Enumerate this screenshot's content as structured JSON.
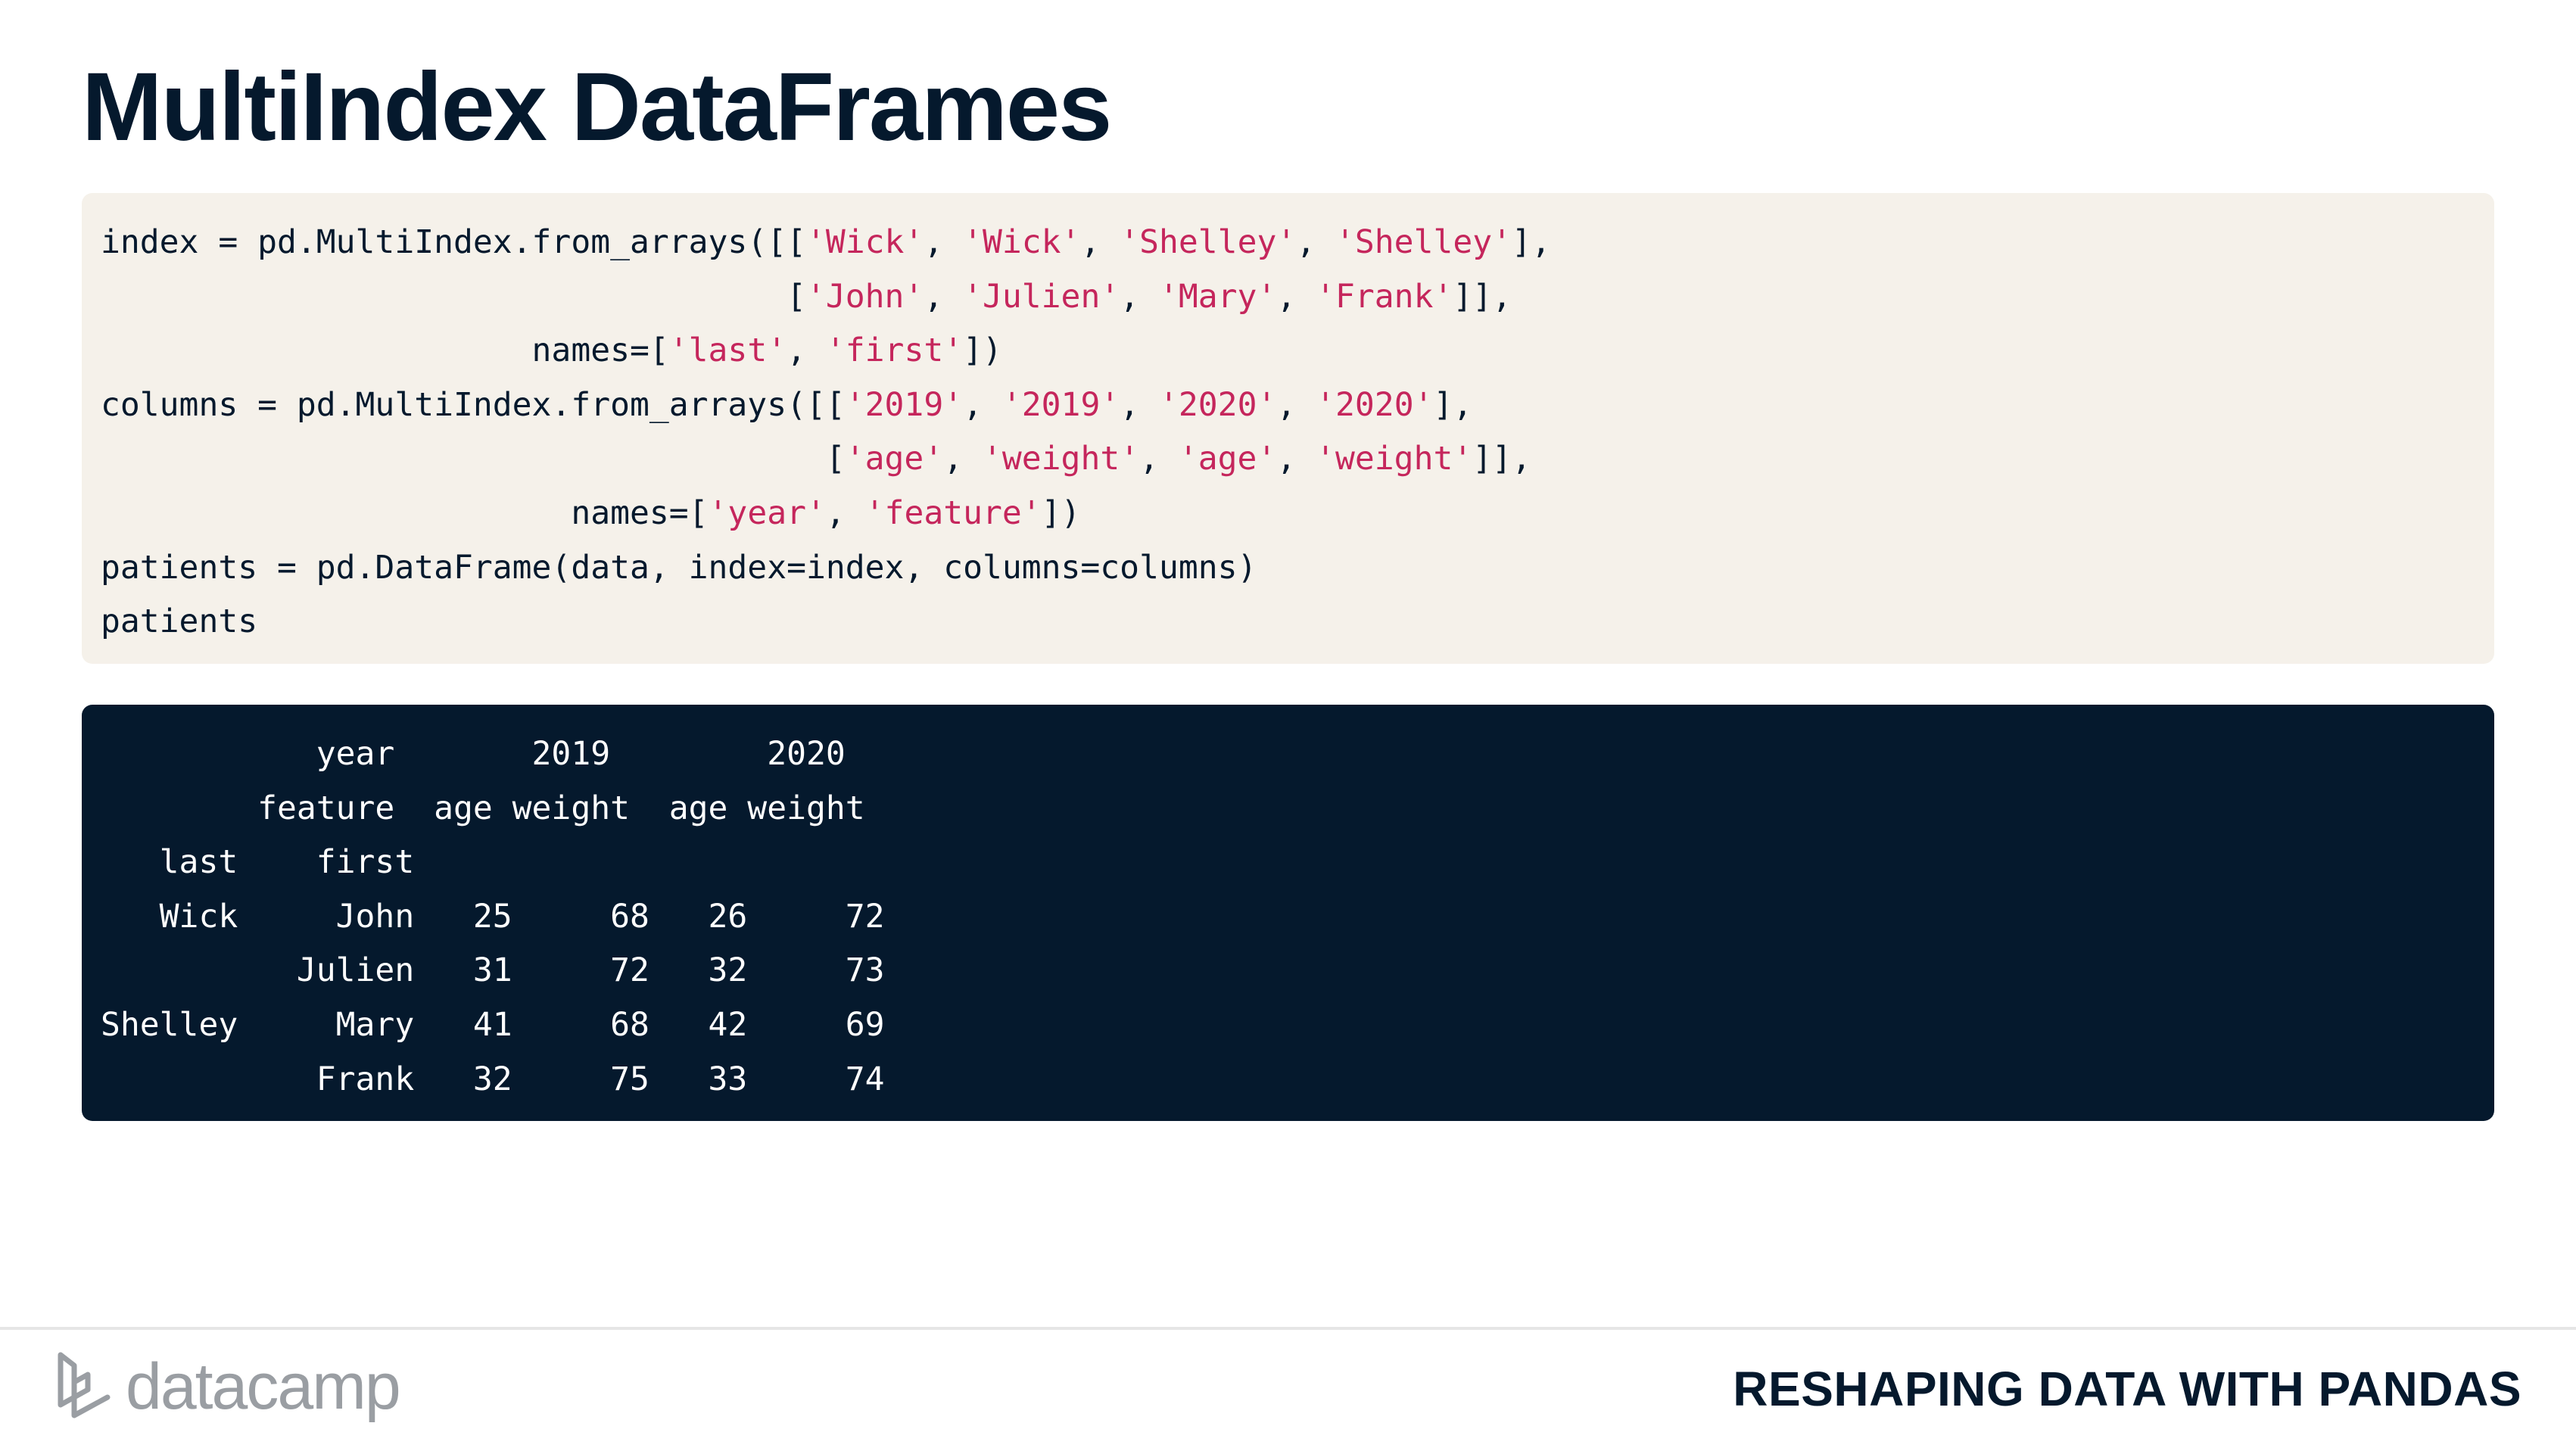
{
  "slide": {
    "title": "MultiIndex DataFrames"
  },
  "code": {
    "lines": [
      [
        {
          "t": "index = pd.MultiIndex.from_arrays([[",
          "k": "plain"
        },
        {
          "t": "'Wick'",
          "k": "str"
        },
        {
          "t": ", ",
          "k": "plain"
        },
        {
          "t": "'Wick'",
          "k": "str"
        },
        {
          "t": ", ",
          "k": "plain"
        },
        {
          "t": "'Shelley'",
          "k": "str"
        },
        {
          "t": ", ",
          "k": "plain"
        },
        {
          "t": "'Shelley'",
          "k": "str"
        },
        {
          "t": "],",
          "k": "plain"
        }
      ],
      [
        {
          "t": "                                   [",
          "k": "plain"
        },
        {
          "t": "'John'",
          "k": "str"
        },
        {
          "t": ", ",
          "k": "plain"
        },
        {
          "t": "'Julien'",
          "k": "str"
        },
        {
          "t": ", ",
          "k": "plain"
        },
        {
          "t": "'Mary'",
          "k": "str"
        },
        {
          "t": ", ",
          "k": "plain"
        },
        {
          "t": "'Frank'",
          "k": "str"
        },
        {
          "t": "]],",
          "k": "plain"
        }
      ],
      [
        {
          "t": "                      names=[",
          "k": "plain"
        },
        {
          "t": "'last'",
          "k": "str"
        },
        {
          "t": ", ",
          "k": "plain"
        },
        {
          "t": "'first'",
          "k": "str"
        },
        {
          "t": "])",
          "k": "plain"
        }
      ],
      [
        {
          "t": "columns = pd.MultiIndex.from_arrays([[",
          "k": "plain"
        },
        {
          "t": "'2019'",
          "k": "str"
        },
        {
          "t": ", ",
          "k": "plain"
        },
        {
          "t": "'2019'",
          "k": "str"
        },
        {
          "t": ", ",
          "k": "plain"
        },
        {
          "t": "'2020'",
          "k": "str"
        },
        {
          "t": ", ",
          "k": "plain"
        },
        {
          "t": "'2020'",
          "k": "str"
        },
        {
          "t": "],",
          "k": "plain"
        }
      ],
      [
        {
          "t": "                                     [",
          "k": "plain"
        },
        {
          "t": "'age'",
          "k": "str"
        },
        {
          "t": ", ",
          "k": "plain"
        },
        {
          "t": "'weight'",
          "k": "str"
        },
        {
          "t": ", ",
          "k": "plain"
        },
        {
          "t": "'age'",
          "k": "str"
        },
        {
          "t": ", ",
          "k": "plain"
        },
        {
          "t": "'weight'",
          "k": "str"
        },
        {
          "t": "]],",
          "k": "plain"
        }
      ],
      [
        {
          "t": "                        names=[",
          "k": "plain"
        },
        {
          "t": "'year'",
          "k": "str"
        },
        {
          "t": ", ",
          "k": "plain"
        },
        {
          "t": "'feature'",
          "k": "str"
        },
        {
          "t": "])",
          "k": "plain"
        }
      ],
      [
        {
          "t": "patients = pd.DataFrame(data, index=index, columns=columns)",
          "k": "plain"
        }
      ],
      [
        {
          "t": "patients",
          "k": "plain"
        }
      ]
    ]
  },
  "output": {
    "lines": [
      "           year       2019        2020",
      "        feature  age weight  age weight",
      "   last    first",
      "   Wick     John   25     68   26     72",
      "          Julien   31     72   32     73",
      "Shelley     Mary   41     68   42     69",
      "           Frank   32     75   33     74"
    ]
  },
  "footer": {
    "logo_text": "datacamp",
    "course_title": "RESHAPING DATA WITH PANDAS"
  },
  "colors": {
    "navy": "#05192d",
    "code_background": "#f5f1ea",
    "string_literal": "#c5265c",
    "logo_gray": "#9a9ea3"
  },
  "icons": {
    "logo_mark": "datacamp-logo-icon"
  }
}
